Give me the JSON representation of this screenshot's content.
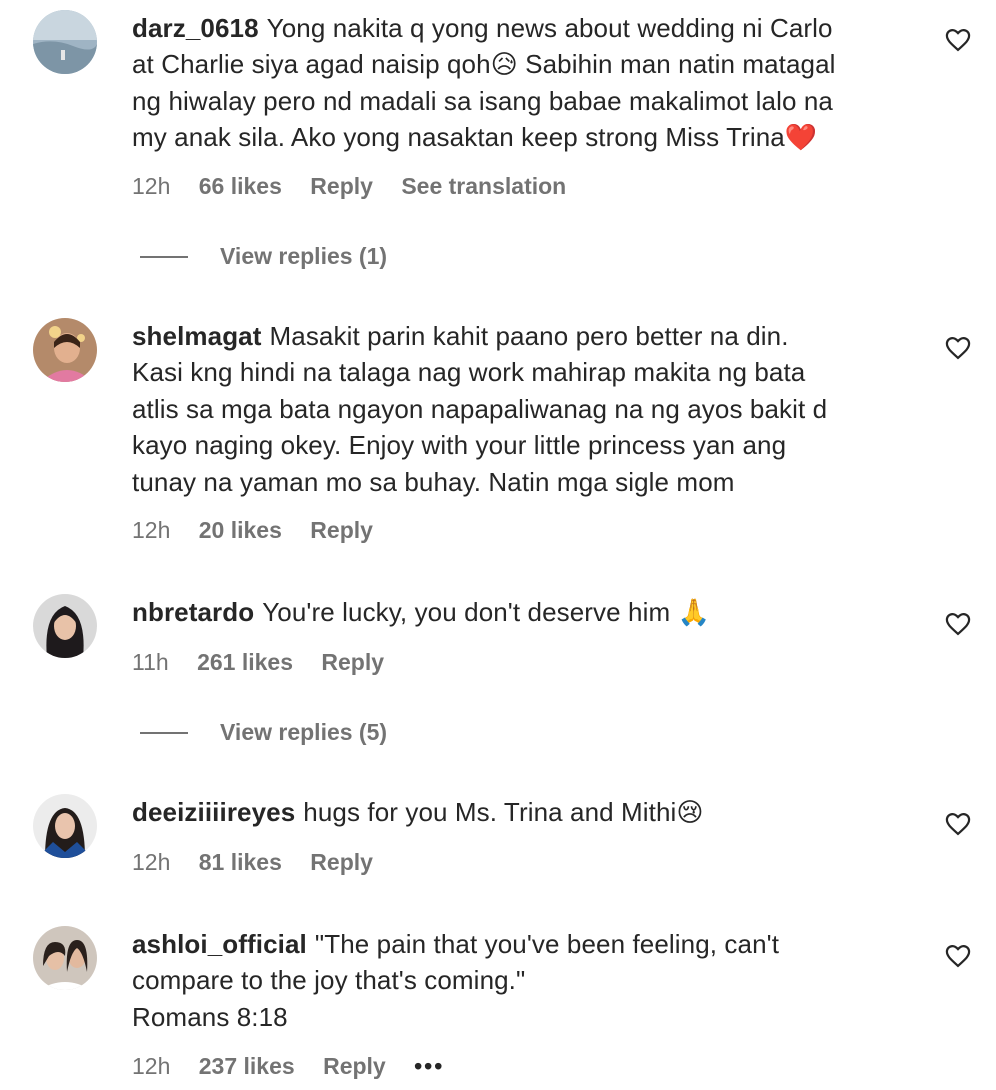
{
  "comments": [
    {
      "username": "darz_0618",
      "lines": [
        "Yong nakita q yong news about wedding ni Carlo",
        "at Charlie siya agad naisip qoh😥 Sabihin man natin matagal",
        "ng hiwalay pero nd madali sa isang babae makalimot lalo na",
        "my anak sila. Ako yong nasaktan keep strong Miss Trina❤️"
      ],
      "time": "12h",
      "likes": "66 likes",
      "reply": "Reply",
      "translate": "See translation",
      "view_replies": "View replies (1)"
    },
    {
      "username": "shelmagat",
      "lines": [
        "Masakit parin kahit paano pero better na din.",
        "Kasi kng hindi na talaga nag work mahirap makita ng bata",
        "atlis sa mga bata ngayon napapaliwanag na ng ayos bakit d",
        "kayo naging okey. Enjoy with your little princess yan ang",
        "tunay na yaman mo sa buhay. Natin mga sigle mom"
      ],
      "time": "12h",
      "likes": "20 likes",
      "reply": "Reply"
    },
    {
      "username": "nbretardo",
      "lines": [
        "You're lucky, you don't deserve him 🙏"
      ],
      "time": "11h",
      "likes": "261 likes",
      "reply": "Reply",
      "view_replies": "View replies (5)"
    },
    {
      "username": "deeiziiiireyes",
      "lines": [
        "hugs for you Ms. Trina and Mithi😢"
      ],
      "time": "12h",
      "likes": "81 likes",
      "reply": "Reply"
    },
    {
      "username": "ashloi_official",
      "lines": [
        "\"The pain that you've been feeling, can't",
        "compare to the joy that's coming.\"",
        "Romans 8:18"
      ],
      "time": "12h",
      "likes": "237 likes",
      "reply": "Reply",
      "more": "•••"
    }
  ],
  "icons": {
    "like": "heart-outline-icon",
    "more": "more-options-icon"
  },
  "colors": {
    "text": "#262626",
    "secondary": "#737373",
    "background": "#ffffff"
  }
}
